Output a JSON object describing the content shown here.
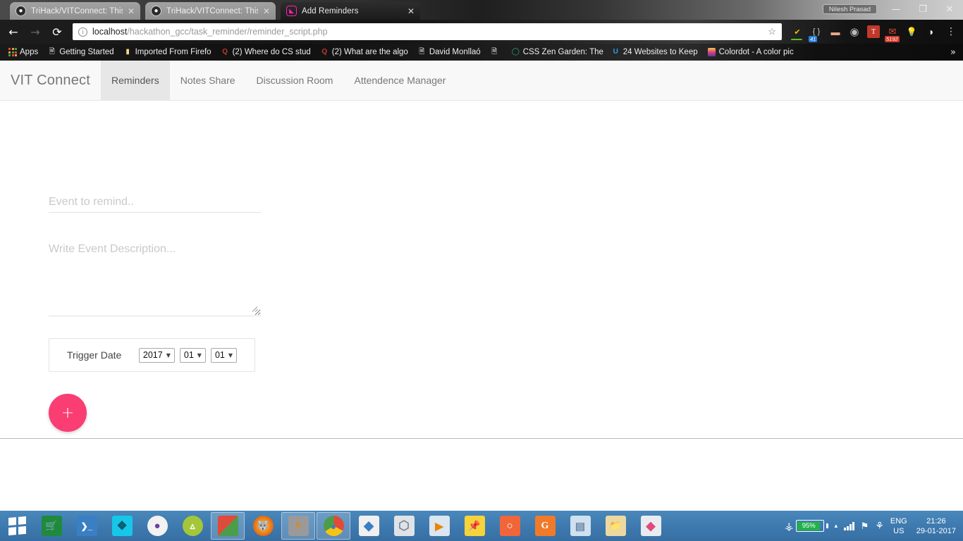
{
  "browser": {
    "tabs": [
      {
        "title": "TriHack/VITConnect: This",
        "icon": "github-icon",
        "active": false,
        "close": "✕"
      },
      {
        "title": "TriHack/VITConnect: This",
        "icon": "github-icon",
        "active": false,
        "close": "✕"
      },
      {
        "title": "Add Reminders",
        "icon": "site-favicon",
        "active": true,
        "close": "✕"
      }
    ],
    "window": {
      "profile": "Nilesh Prasad",
      "minimize": "—",
      "maximize": "❐",
      "close": "✕"
    },
    "nav": {
      "back": "←",
      "forward": "→",
      "reload": "⟳",
      "menu": "⋮"
    },
    "omnibox": {
      "info_icon": "i",
      "url_host": "localhost",
      "url_path": "/hackathon_gcc/task_reminder/reminder_script.php",
      "star": "☆"
    },
    "extensions": [
      {
        "name": "web-of-trust-icon",
        "glyph": "✔",
        "color": "#f0c000",
        "badge": "",
        "badge_color": ""
      },
      {
        "name": "braces-icon",
        "glyph": "{ }",
        "color": "#cfcfcf",
        "badge": "41",
        "badge_color": "blue"
      },
      {
        "name": "capsule-icon",
        "glyph": "▬",
        "color": "#e8a988",
        "badge": "",
        "badge_color": ""
      },
      {
        "name": "keyhole-icon",
        "glyph": "◉",
        "color": "#b9b9b9",
        "badge": "",
        "badge_color": ""
      },
      {
        "name": "todoist-icon",
        "glyph": "T",
        "color": "#d84b3a",
        "badge": "",
        "badge_color": ""
      },
      {
        "name": "mail-icon",
        "glyph": "✉",
        "color": "#e04a3a",
        "badge": "5192",
        "badge_color": "red"
      },
      {
        "name": "lightbulb-icon",
        "glyph": "Ὂ1",
        "color": "#cfcfcf",
        "badge": "",
        "badge_color": ""
      },
      {
        "name": "pocket-icon",
        "glyph": "◕",
        "color": "#eaeaea",
        "badge": "",
        "badge_color": ""
      }
    ],
    "bookmarks": [
      {
        "label": "Apps",
        "icon": "apps-grid-icon"
      },
      {
        "label": "Getting Started",
        "icon": "page-icon"
      },
      {
        "label": "Imported From Firefo",
        "icon": "folder-icon"
      },
      {
        "label": "(2) Where do CS stud",
        "icon": "quora-icon"
      },
      {
        "label": "(2) What are the algo",
        "icon": "quora-icon"
      },
      {
        "label": "David Monllaó",
        "icon": "page-icon"
      },
      {
        "label": "",
        "icon": "page-icon"
      },
      {
        "label": "CSS Zen Garden: The",
        "icon": "zen-icon"
      },
      {
        "label": "24 Websites to Keep",
        "icon": "u-icon"
      },
      {
        "label": "Colordot - A color pic",
        "icon": "colordot-icon"
      }
    ],
    "bookmarks_overflow": "»"
  },
  "site": {
    "brand": "VIT Connect",
    "navitems": [
      {
        "label": "Reminders",
        "active": true
      },
      {
        "label": "Notes Share",
        "active": false
      },
      {
        "label": "Discussion Room",
        "active": false
      },
      {
        "label": "Attendence Manager",
        "active": false
      }
    ]
  },
  "form": {
    "event_placeholder": "Event to remind..",
    "event_value": "",
    "description_placeholder": "Write Event Description...",
    "description_value": "",
    "trigger_date_label": "Trigger Date",
    "selects": [
      {
        "name": "year-select",
        "value": "2017",
        "caret": "▼"
      },
      {
        "name": "month-select",
        "value": "01",
        "caret": "▼"
      },
      {
        "name": "day-select",
        "value": "01",
        "caret": "▼"
      }
    ],
    "submit_label": "+",
    "accent_color": "#fa3d72"
  },
  "taskbar": {
    "start": "windows-logo",
    "apps": [
      {
        "name": "store-icon",
        "glyph": "ὬD",
        "bg": "#1e8a3c",
        "running": false
      },
      {
        "name": "powershell-icon",
        "glyph": "❯_",
        "bg": "#3a7fc4",
        "running": false
      },
      {
        "name": "share-icon",
        "glyph": "✶",
        "bg": "#16c7e8",
        "running": false
      },
      {
        "name": "github-desktop-icon",
        "glyph": "●",
        "bg": "#f2f2f2",
        "running": false
      },
      {
        "name": "android-studio-icon",
        "glyph": "A",
        "bg": "#a4c639",
        "running": false
      },
      {
        "name": "windows-explorer-icon",
        "glyph": "⊞",
        "bg": "#d8d8d8",
        "running": true
      },
      {
        "name": "firefox-icon",
        "glyph": "ᾘA",
        "bg": "#e8670c",
        "running": false
      },
      {
        "name": "sublime-text-icon",
        "glyph": "S",
        "bg": "#9a9a9a",
        "running": true
      },
      {
        "name": "google-chrome-icon",
        "glyph": "◎",
        "bg": "#f5f5f5",
        "running": true
      },
      {
        "name": "photoshop-diamond-icon",
        "glyph": "◆",
        "bg": "#f0f0f0",
        "running": false
      },
      {
        "name": "virtualbox-icon",
        "glyph": "⬡",
        "bg": "#dfe3e8",
        "running": false
      },
      {
        "name": "media-player-icon",
        "glyph": "▶",
        "bg": "#dbe6f0",
        "running": false
      },
      {
        "name": "sticky-notes-icon",
        "glyph": "ὌC",
        "bg": "#f5d33a",
        "running": false
      },
      {
        "name": "screenshot-icon",
        "glyph": "○",
        "bg": "#f0663a",
        "running": false
      },
      {
        "name": "foxit-pdf-icon",
        "glyph": "G",
        "bg": "#f07a2a",
        "running": false
      },
      {
        "name": "notepad-icon",
        "glyph": "▤",
        "bg": "#cfe0ef",
        "running": false
      },
      {
        "name": "file-manager-icon",
        "glyph": "Ὄ1",
        "bg": "#ecd9a0",
        "running": false
      },
      {
        "name": "paint-icon",
        "glyph": "◆",
        "bg": "#e8ecf0",
        "running": false
      }
    ],
    "tray": {
      "battery_percent": "95%",
      "chevron": "▴",
      "signal": "signal-bars-icon",
      "flag": "action-center-icon",
      "defender": "defender-icon",
      "lang_line1": "ENG",
      "lang_line2": "US",
      "time": "21:26",
      "date": "29-01-2017"
    }
  }
}
